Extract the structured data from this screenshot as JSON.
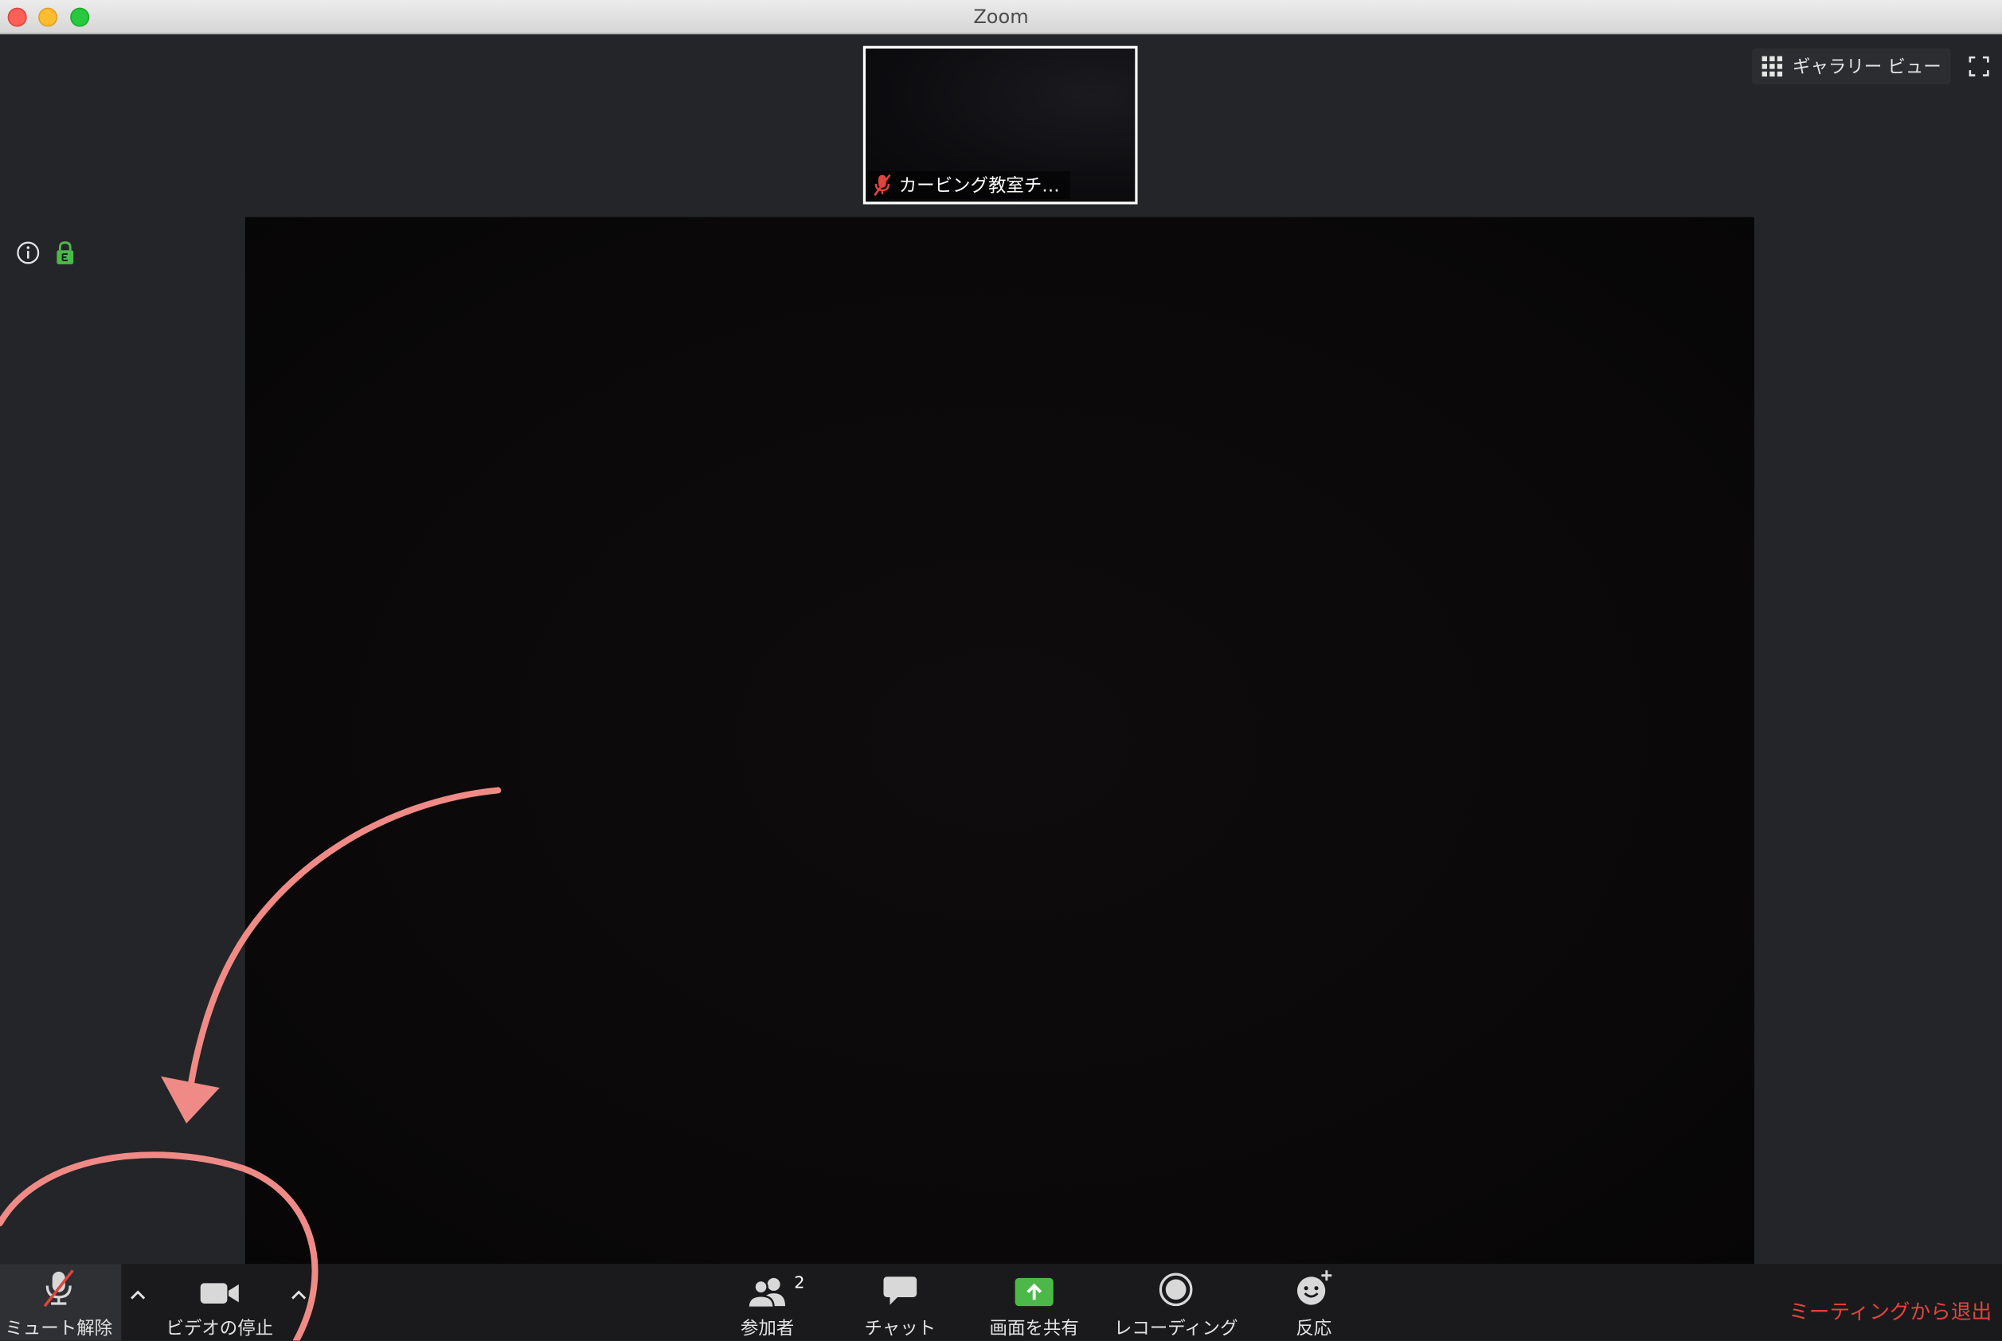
{
  "window": {
    "title": "Zoom"
  },
  "thumbnail": {
    "participant_name": "カービング教室チ…"
  },
  "view_controls": {
    "gallery_label": "ギャラリー ビュー"
  },
  "toolbar": {
    "unmute_label": "ミュート解除",
    "video_label": "ビデオの停止",
    "participants_label": "参加者",
    "participants_count": "2",
    "chat_label": "チャット",
    "share_label": "画面を共有",
    "record_label": "レコーディング",
    "reactions_label": "反応",
    "leave_label": "ミーティングから退出"
  },
  "colors": {
    "accent_green": "#4cb84a",
    "leave_red": "#e0453b",
    "annotation_pink": "#f08a86",
    "mute_red": "#e0453b"
  },
  "icons": [
    "info-icon",
    "lock-icon",
    "gallery-grid-icon",
    "fullscreen-icon",
    "microphone-muted-icon",
    "video-camera-icon",
    "participants-icon",
    "chat-icon",
    "share-screen-icon",
    "record-icon",
    "reaction-icon",
    "caret-up-icon"
  ]
}
